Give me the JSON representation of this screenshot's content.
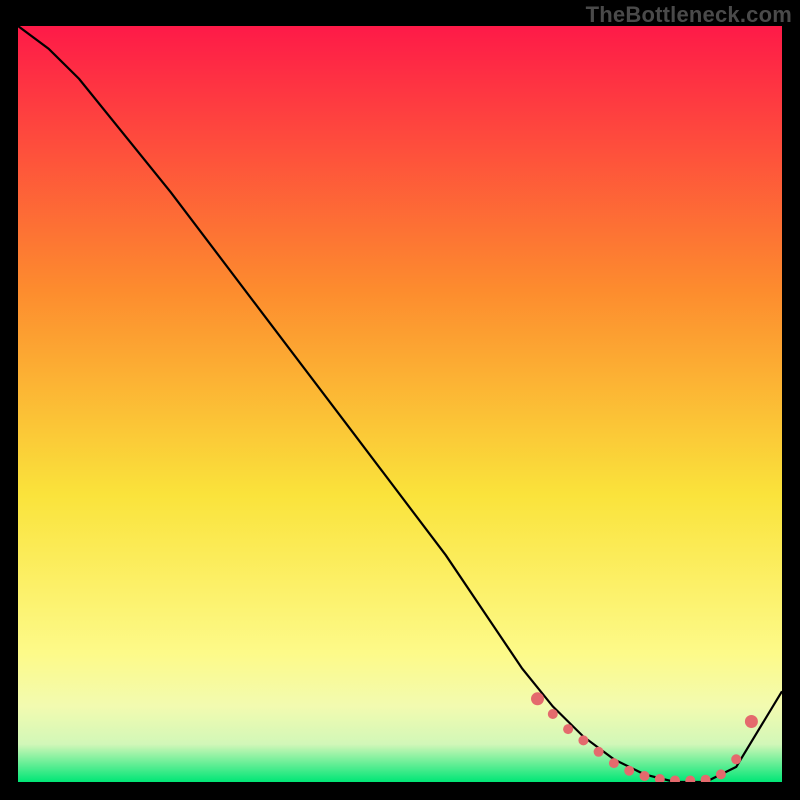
{
  "watermark": "TheBottleneck.com",
  "colors": {
    "grad_top": "#fe1a48",
    "grad_mid1": "#fd8c2e",
    "grad_mid2": "#fae33b",
    "grad_mid3": "#fdfa89",
    "grad_mid4": "#f2fbb0",
    "grad_mid5": "#d2f7b8",
    "grad_bottom": "#00e676",
    "curve": "#000000",
    "marker": "#e46a6d",
    "frame": "#000000"
  },
  "chart_data": {
    "type": "line",
    "title": "",
    "xlabel": "",
    "ylabel": "",
    "xlim": [
      0,
      100
    ],
    "ylim": [
      0,
      100
    ],
    "series": [
      {
        "name": "bottleneck-curve",
        "x": [
          0,
          4,
          8,
          20,
          32,
          44,
          56,
          66,
          70,
          74,
          78,
          82,
          86,
          90,
          94,
          100
        ],
        "y": [
          100,
          97,
          93,
          78,
          62,
          46,
          30,
          15,
          10,
          6,
          3,
          1,
          0,
          0,
          2,
          12
        ]
      }
    ],
    "markers": {
      "name": "highlight-points",
      "x": [
        68,
        70,
        72,
        74,
        76,
        78,
        80,
        82,
        84,
        86,
        88,
        90,
        92,
        94,
        96
      ],
      "y": [
        11,
        9,
        7,
        5.5,
        4,
        2.5,
        1.5,
        0.8,
        0.4,
        0.2,
        0.2,
        0.3,
        1,
        3,
        8
      ]
    }
  }
}
